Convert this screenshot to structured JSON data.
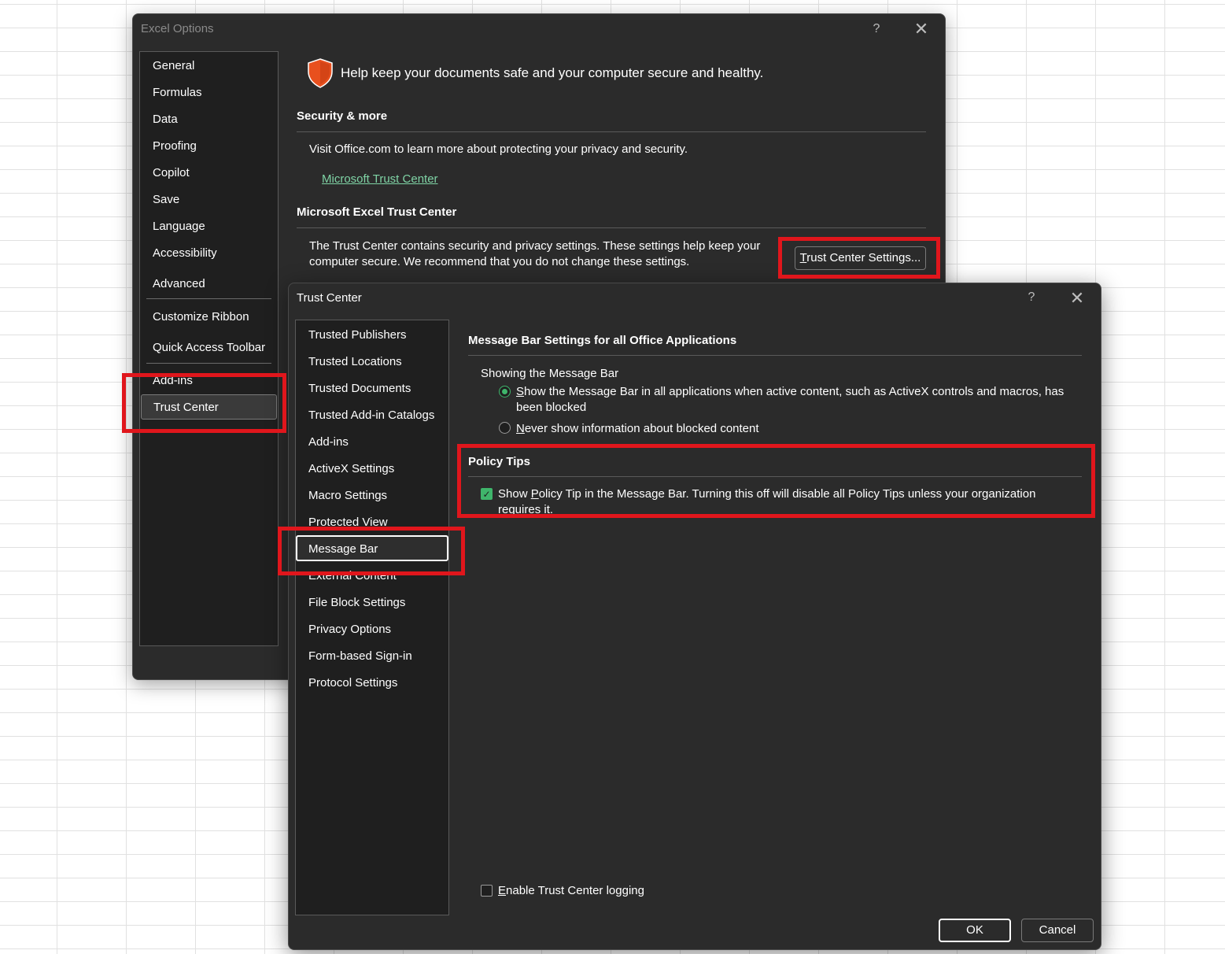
{
  "excel_options": {
    "title": "Excel Options",
    "help_label": "?",
    "nav": [
      "General",
      "Formulas",
      "Data",
      "Proofing",
      "Copilot",
      "Save",
      "Language",
      "Accessibility",
      "Advanced",
      "Customize Ribbon",
      "Quick Access Toolbar",
      "Add-ins",
      "Trust Center"
    ],
    "selected_nav": "Trust Center",
    "header_text": "Help keep your documents safe and your computer secure and healthy.",
    "security_title": "Security & more",
    "security_text": "Visit Office.com to learn more about protecting your privacy and security.",
    "security_link": "Microsoft Trust Center",
    "trust_title": "Microsoft Excel Trust Center",
    "trust_text": "The Trust Center contains security and privacy settings. These settings help keep your computer secure. We recommend that you do not change these settings.",
    "trust_button": {
      "accel": "T",
      "rest": "rust Center Settings..."
    }
  },
  "trust_center": {
    "title": "Trust Center",
    "help_label": "?",
    "nav": [
      "Trusted Publishers",
      "Trusted Locations",
      "Trusted Documents",
      "Trusted Add-in Catalogs",
      "Add-ins",
      "ActiveX Settings",
      "Macro Settings",
      "Protected View",
      "Message Bar",
      "External Content",
      "File Block Settings",
      "Privacy Options",
      "Form-based Sign-in",
      "Protocol Settings"
    ],
    "selected_nav": "Message Bar",
    "section_title": "Message Bar Settings for all Office Applications",
    "showing_label": "Showing the Message Bar",
    "radio1": {
      "accel": "S",
      "rest": "how the Message Bar in all applications when active content, such as ActiveX controls and macros, has been blocked",
      "checked": true
    },
    "radio2": {
      "accel": "N",
      "rest": "ever show information about blocked content",
      "checked": false
    },
    "policy_title": "Policy Tips",
    "policy_check": {
      "pre": "Show ",
      "accel": "P",
      "rest": "olicy Tip in the Message Bar. Turning this off will disable all Policy Tips unless your organization requires it.",
      "checked": true
    },
    "logging": {
      "accel": "E",
      "rest": "nable Trust Center logging",
      "checked": false
    },
    "ok_label": "OK",
    "cancel_label": "Cancel"
  },
  "colors": {
    "highlight": "#e0161c",
    "dialog_bg": "#2b2b2b",
    "nav_bg": "#1f1f1f",
    "accent_green": "#3fb56b",
    "link_green": "#7fd3a5",
    "shield": "#e8501e"
  }
}
